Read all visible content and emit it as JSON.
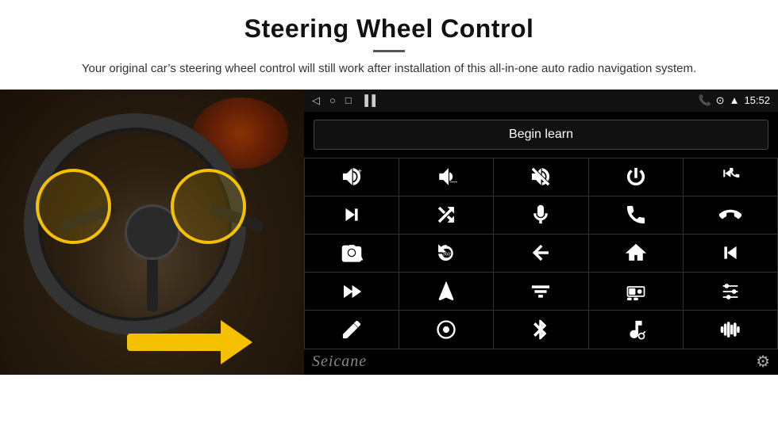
{
  "header": {
    "title": "Steering Wheel Control",
    "subtitle": "Your original car’s steering wheel control will still work after installation of this all-in-one auto radio navigation system."
  },
  "status_bar": {
    "time": "15:52",
    "icons": [
      "back-arrow",
      "home-circle",
      "square",
      "signal-bars",
      "phone-icon",
      "location-icon",
      "wifi-icon"
    ]
  },
  "begin_learn_button": "Begin learn",
  "icon_grid": [
    {
      "id": "vol-up",
      "label": "Volume Up"
    },
    {
      "id": "vol-down",
      "label": "Volume Down"
    },
    {
      "id": "vol-mute",
      "label": "Mute"
    },
    {
      "id": "power",
      "label": "Power"
    },
    {
      "id": "prev-track-phone",
      "label": "Prev+Phone"
    },
    {
      "id": "next-track",
      "label": "Next Track"
    },
    {
      "id": "shuffle",
      "label": "Shuffle"
    },
    {
      "id": "mic",
      "label": "Microphone"
    },
    {
      "id": "phone",
      "label": "Phone"
    },
    {
      "id": "hang-up",
      "label": "Hang Up"
    },
    {
      "id": "camera",
      "label": "Camera"
    },
    {
      "id": "360-view",
      "label": "360 View"
    },
    {
      "id": "back",
      "label": "Back"
    },
    {
      "id": "home",
      "label": "Home"
    },
    {
      "id": "skip-prev",
      "label": "Skip Previous"
    },
    {
      "id": "fast-forward",
      "label": "Fast Forward"
    },
    {
      "id": "navigate",
      "label": "Navigate"
    },
    {
      "id": "equalizer",
      "label": "Equalizer"
    },
    {
      "id": "dvr",
      "label": "DVR"
    },
    {
      "id": "settings-sliders",
      "label": "Settings Sliders"
    },
    {
      "id": "pen",
      "label": "Pen"
    },
    {
      "id": "circle-dot",
      "label": "Circle"
    },
    {
      "id": "bluetooth",
      "label": "Bluetooth"
    },
    {
      "id": "music-settings",
      "label": "Music Settings"
    },
    {
      "id": "waveform",
      "label": "Waveform"
    }
  ],
  "watermark": "Seicane",
  "gear": "⚙"
}
